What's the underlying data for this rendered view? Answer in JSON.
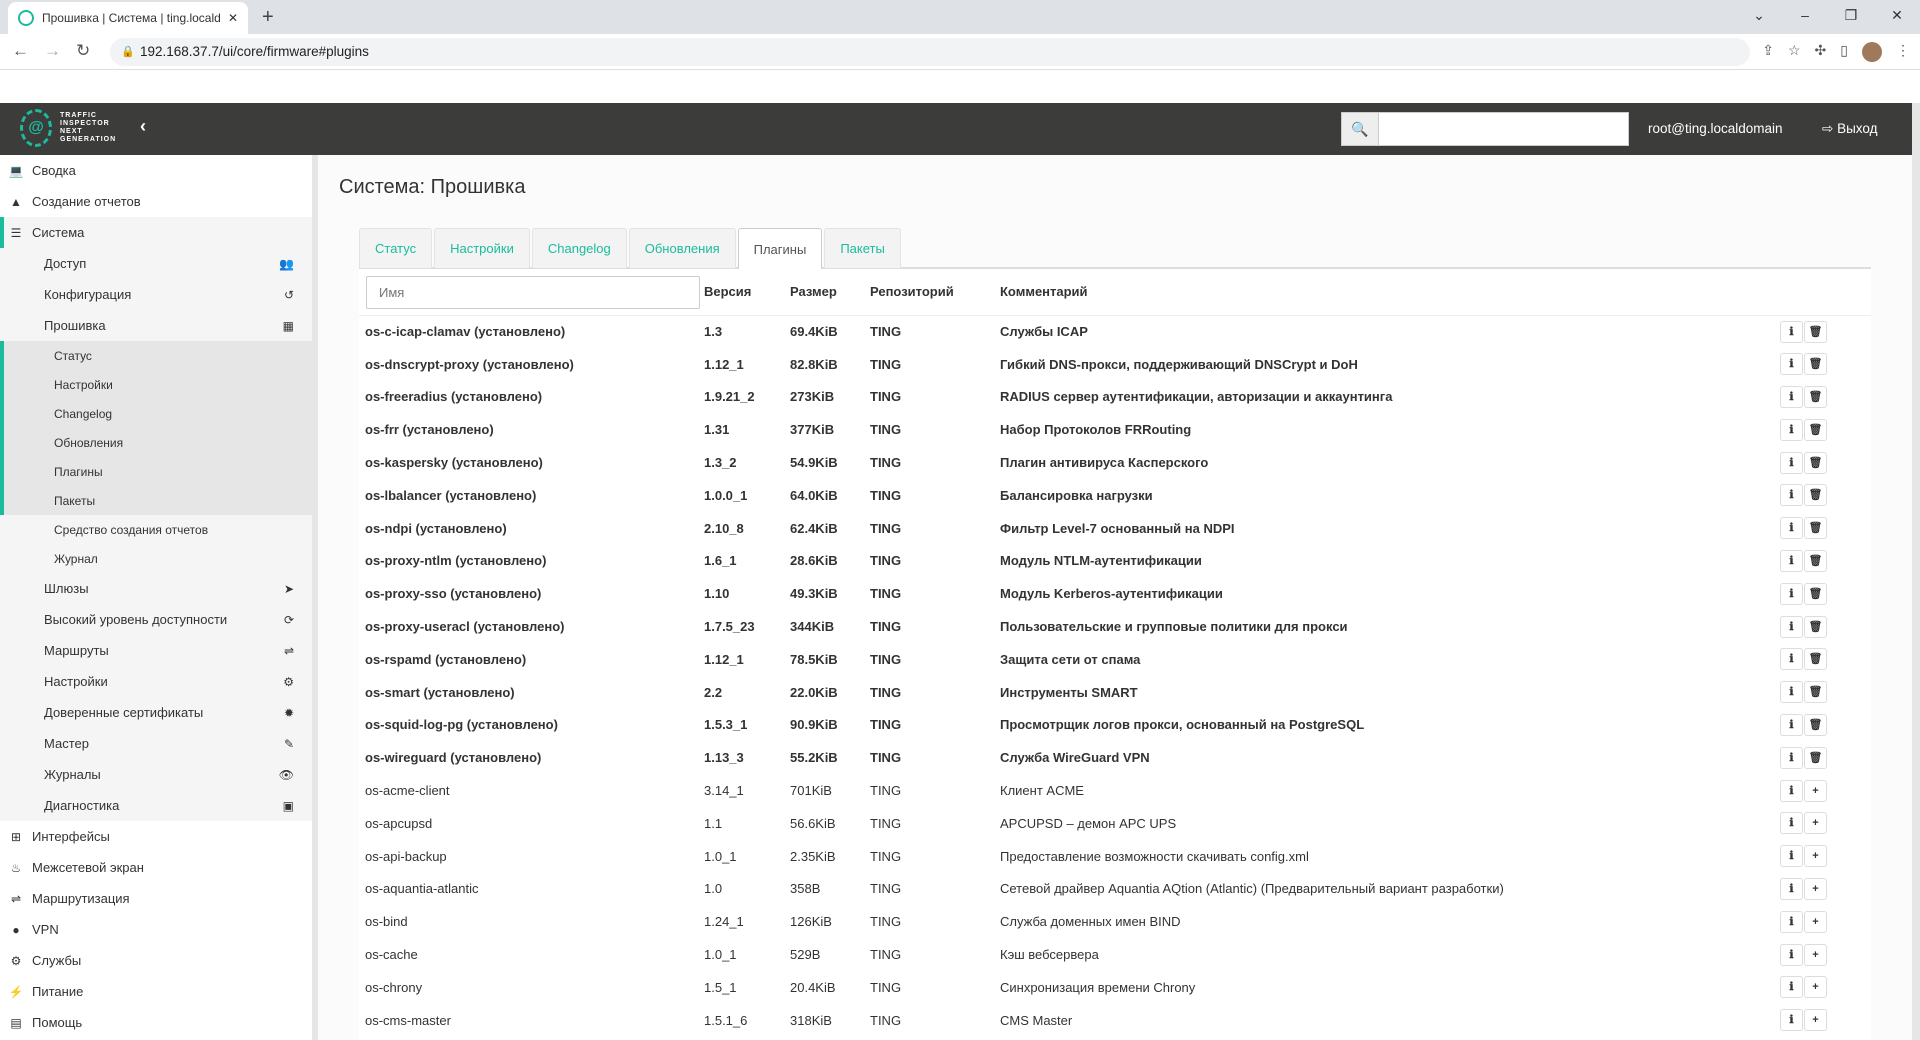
{
  "browser": {
    "tab_title": "Прошивка | Система | ting.localdomain",
    "url": "192.168.37.7/ui/core/firmware#plugins"
  },
  "header": {
    "logo_lines": [
      "TRAFFIC",
      "INSPECTOR",
      "NEXT",
      "GENERATION"
    ],
    "search_placeholder": "",
    "user": "root@ting.localdomain",
    "logout": "Выход"
  },
  "sidebar": {
    "top": [
      {
        "label": "Сводка",
        "icon": "laptop-icon"
      },
      {
        "label": "Создание отчетов",
        "icon": "area-chart-icon"
      }
    ],
    "system": {
      "label": "Система",
      "icon": "server-icon"
    },
    "system_items_before": [
      {
        "label": "Доступ",
        "icon": "users-icon"
      },
      {
        "label": "Конфигурация",
        "icon": "history-icon"
      },
      {
        "label": "Прошивка",
        "icon": "building-icon"
      }
    ],
    "firmware_items": [
      "Статус",
      "Настройки",
      "Changelog",
      "Обновления",
      "Плагины",
      "Пакеты"
    ],
    "firmware_items_after": [
      "Средство создания отчетов",
      "Журнал"
    ],
    "system_items_after": [
      {
        "label": "Шлюзы",
        "icon": "location-arrow-icon"
      },
      {
        "label": "Высокий уровень доступности",
        "icon": "refresh-icon"
      },
      {
        "label": "Маршруты",
        "icon": "map-signs-icon"
      },
      {
        "label": "Настройки",
        "icon": "cogs-icon"
      },
      {
        "label": "Доверенные сертификаты",
        "icon": "certificate-icon"
      },
      {
        "label": "Мастер",
        "icon": "magic-icon"
      },
      {
        "label": "Журналы",
        "icon": "eye-icon"
      },
      {
        "label": "Диагностика",
        "icon": "medkit-icon"
      }
    ],
    "bottom": [
      {
        "label": "Интерфейсы",
        "icon": "sitemap-icon"
      },
      {
        "label": "Межсетевой экран",
        "icon": "fire-icon"
      },
      {
        "label": "Маршрутизация",
        "icon": "map-signs-icon"
      },
      {
        "label": "VPN",
        "icon": "globe-icon"
      },
      {
        "label": "Службы",
        "icon": "cog-icon"
      },
      {
        "label": "Питание",
        "icon": "plug-icon"
      },
      {
        "label": "Помощь",
        "icon": "book-icon"
      }
    ]
  },
  "page": {
    "title": "Система: Прошивка",
    "tabs": [
      {
        "label": "Статус"
      },
      {
        "label": "Настройки"
      },
      {
        "label": "Changelog"
      },
      {
        "label": "Обновления"
      },
      {
        "label": "Плагины",
        "active": true
      },
      {
        "label": "Пакеты"
      }
    ],
    "table": {
      "name_placeholder": "Имя",
      "headers": [
        "Версия",
        "Размер",
        "Репозиторий",
        "Комментарий"
      ],
      "rows": [
        {
          "name": "os-c-icap-clamav (установлено)",
          "version": "1.3",
          "size": "69.4KiB",
          "repo": "TING",
          "comment": "Службы ICAP",
          "installed": true
        },
        {
          "name": "os-dnscrypt-proxy (установлено)",
          "version": "1.12_1",
          "size": "82.8KiB",
          "repo": "TING",
          "comment": "Гибкий DNS-прокси, поддерживающий DNSCrypt и DoH",
          "installed": true
        },
        {
          "name": "os-freeradius (установлено)",
          "version": "1.9.21_2",
          "size": "273KiB",
          "repo": "TING",
          "comment": "RADIUS сервер аутентификации, авторизации и аккаунтинга",
          "installed": true
        },
        {
          "name": "os-frr (установлено)",
          "version": "1.31",
          "size": "377KiB",
          "repo": "TING",
          "comment": "Набор Протоколов FRRouting",
          "installed": true
        },
        {
          "name": "os-kaspersky (установлено)",
          "version": "1.3_2",
          "size": "54.9KiB",
          "repo": "TING",
          "comment": "Плагин антивируса Касперского",
          "installed": true
        },
        {
          "name": "os-lbalancer (установлено)",
          "version": "1.0.0_1",
          "size": "64.0KiB",
          "repo": "TING",
          "comment": "Балансировка нагрузки",
          "installed": true
        },
        {
          "name": "os-ndpi (установлено)",
          "version": "2.10_8",
          "size": "62.4KiB",
          "repo": "TING",
          "comment": "Фильтр Level-7 основанный на NDPI",
          "installed": true
        },
        {
          "name": "os-proxy-ntlm (установлено)",
          "version": "1.6_1",
          "size": "28.6KiB",
          "repo": "TING",
          "comment": "Модуль NTLM-аутентификации",
          "installed": true
        },
        {
          "name": "os-proxy-sso (установлено)",
          "version": "1.10",
          "size": "49.3KiB",
          "repo": "TING",
          "comment": "Модуль Kerberos-аутентификации",
          "installed": true
        },
        {
          "name": "os-proxy-useracl (установлено)",
          "version": "1.7.5_23",
          "size": "344KiB",
          "repo": "TING",
          "comment": "Пользовательские и групповые политики для прокси",
          "installed": true
        },
        {
          "name": "os-rspamd (установлено)",
          "version": "1.12_1",
          "size": "78.5KiB",
          "repo": "TING",
          "comment": "Защита сети от спама",
          "installed": true
        },
        {
          "name": "os-smart (установлено)",
          "version": "2.2",
          "size": "22.0KiB",
          "repo": "TING",
          "comment": "Инструменты SMART",
          "installed": true
        },
        {
          "name": "os-squid-log-pg (установлено)",
          "version": "1.5.3_1",
          "size": "90.9KiB",
          "repo": "TING",
          "comment": "Просмотрщик логов прокси, основанный на PostgreSQL",
          "installed": true
        },
        {
          "name": "os-wireguard (установлено)",
          "version": "1.13_3",
          "size": "55.2KiB",
          "repo": "TING",
          "comment": "Служба WireGuard VPN",
          "installed": true
        },
        {
          "name": "os-acme-client",
          "version": "3.14_1",
          "size": "701KiB",
          "repo": "TING",
          "comment": "Клиент ACME",
          "installed": false
        },
        {
          "name": "os-apcupsd",
          "version": "1.1",
          "size": "56.6KiB",
          "repo": "TING",
          "comment": "APCUPSD – демон APC UPS",
          "installed": false
        },
        {
          "name": "os-api-backup",
          "version": "1.0_1",
          "size": "2.35KiB",
          "repo": "TING",
          "comment": "Предоставление возможности скачивать config.xml",
          "installed": false
        },
        {
          "name": "os-aquantia-atlantic",
          "version": "1.0",
          "size": "358B",
          "repo": "TING",
          "comment": "Сетевой драйвер Aquantia AQtion (Atlantic) (Предварительный вариант разработки)",
          "installed": false
        },
        {
          "name": "os-bind",
          "version": "1.24_1",
          "size": "126KiB",
          "repo": "TING",
          "comment": "Служба доменных имен BIND",
          "installed": false
        },
        {
          "name": "os-cache",
          "version": "1.0_1",
          "size": "529B",
          "repo": "TING",
          "comment": "Кэш вебсервера",
          "installed": false
        },
        {
          "name": "os-chrony",
          "version": "1.5_1",
          "size": "20.4KiB",
          "repo": "TING",
          "comment": "Синхронизация времени Chrony",
          "installed": false
        },
        {
          "name": "os-cms-master",
          "version": "1.5.1_6",
          "size": "318KiB",
          "repo": "TING",
          "comment": "CMS Master",
          "installed": false
        }
      ]
    }
  },
  "colors": {
    "accent": "#1abc9c",
    "header_bg": "#3c3c3b"
  }
}
